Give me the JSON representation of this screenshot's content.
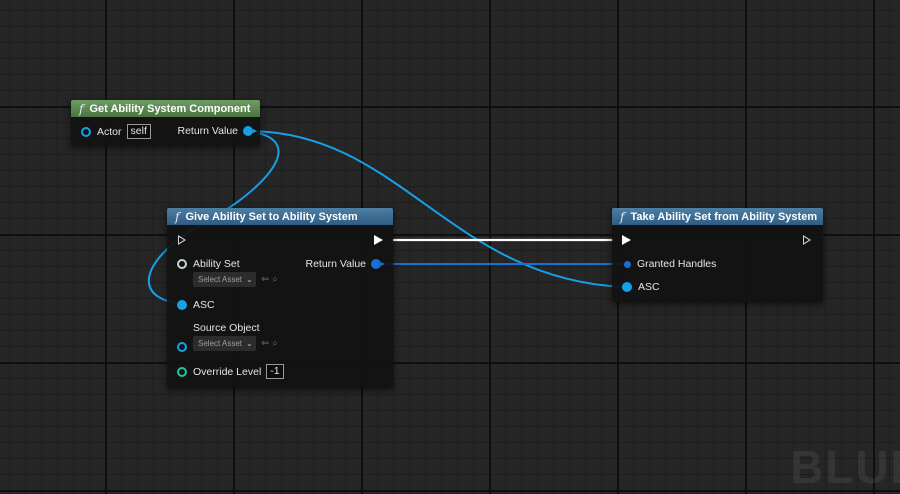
{
  "nodes": {
    "get_asc": {
      "title": "Get Ability System Component",
      "actor_label": "Actor",
      "actor_value": "self",
      "return_label": "Return Value",
      "header_color": "#5e8a55"
    },
    "give": {
      "title": "Give Ability Set to Ability System",
      "ability_set_label": "Ability Set",
      "ability_set_value": "Select Asset",
      "return_label": "Return Value",
      "asc_label": "ASC",
      "source_object_label": "Source Object",
      "source_object_value": "Select Asset",
      "override_level_label": "Override Level",
      "override_level_value": "-1",
      "header_color": "#3f6f96"
    },
    "take": {
      "title": "Take Ability Set from Ability System",
      "granted_label": "Granted Handles",
      "asc_label": "ASC",
      "header_color": "#3f6f96"
    }
  },
  "icons": {
    "function": "f",
    "chevron": "⌄",
    "use_selected": "⇐",
    "browse": "⌕"
  },
  "watermark": "BLUE",
  "colors": {
    "object_pin": "#16a0e8",
    "struct_pin": "#1670d8",
    "int_pin": "#22c4a4",
    "exec": "#ffffff"
  }
}
